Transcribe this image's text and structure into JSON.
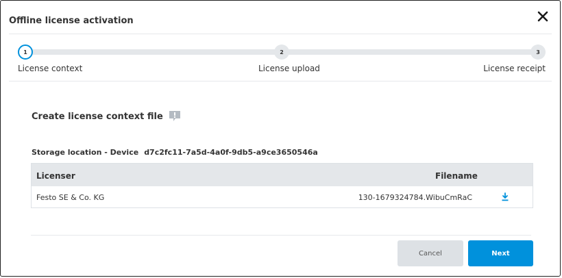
{
  "dialog": {
    "title": "Offline license activation"
  },
  "stepper": {
    "steps": [
      {
        "number": "1",
        "label": "License context",
        "state": "active"
      },
      {
        "number": "2",
        "label": "License upload",
        "state": "inactive"
      },
      {
        "number": "3",
        "label": "License receipt",
        "state": "inactive"
      }
    ]
  },
  "section": {
    "title": "Create license context file",
    "info_icon": "info-comment-icon"
  },
  "storage": {
    "label": "Storage location - Device",
    "device_id": "d7c2fc11-7a5d-4a0f-9db5-a9ce3650546a"
  },
  "table": {
    "headers": {
      "licenser": "Licenser",
      "filename": "Filename"
    },
    "rows": [
      {
        "licenser": "Festo SE & Co. KG",
        "filename": "130-1679324784.WibuCmRaC",
        "action_icon": "download-icon"
      }
    ]
  },
  "buttons": {
    "cancel": "Cancel",
    "next": "Next"
  },
  "colors": {
    "accent": "#0091dc",
    "track": "#e4e7ea",
    "cancel_bg": "#dde1e5"
  }
}
